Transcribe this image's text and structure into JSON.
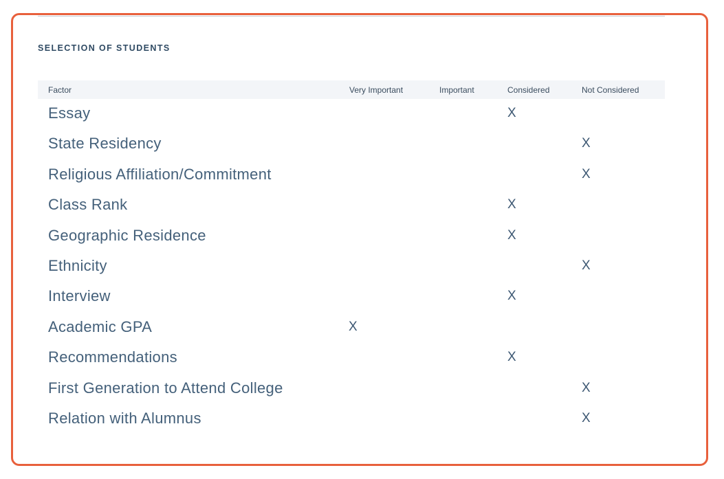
{
  "section": {
    "title": "SELECTION OF STUDENTS"
  },
  "table": {
    "headers": [
      "Factor",
      "Very Important",
      "Important",
      "Considered",
      "Not Considered"
    ],
    "mark_symbol": "X",
    "rows": [
      {
        "factor": "Essay",
        "level": "Considered",
        "vi": "",
        "im": "",
        "co": "X",
        "nc": ""
      },
      {
        "factor": "State Residency",
        "level": "Not Considered",
        "vi": "",
        "im": "",
        "co": "",
        "nc": "X"
      },
      {
        "factor": "Religious Affiliation/Commitment",
        "level": "Not Considered",
        "vi": "",
        "im": "",
        "co": "",
        "nc": "X"
      },
      {
        "factor": "Class Rank",
        "level": "Considered",
        "vi": "",
        "im": "",
        "co": "X",
        "nc": ""
      },
      {
        "factor": "Geographic Residence",
        "level": "Considered",
        "vi": "",
        "im": "",
        "co": "X",
        "nc": ""
      },
      {
        "factor": "Ethnicity",
        "level": "Not Considered",
        "vi": "",
        "im": "",
        "co": "",
        "nc": "X"
      },
      {
        "factor": "Interview",
        "level": "Considered",
        "vi": "",
        "im": "",
        "co": "X",
        "nc": ""
      },
      {
        "factor": "Academic GPA",
        "level": "Very Important",
        "vi": "X",
        "im": "",
        "co": "",
        "nc": ""
      },
      {
        "factor": "Recommendations",
        "level": "Considered",
        "vi": "",
        "im": "",
        "co": "X",
        "nc": ""
      },
      {
        "factor": "First Generation to Attend College",
        "level": "Not Considered",
        "vi": "",
        "im": "",
        "co": "",
        "nc": "X"
      },
      {
        "factor": "Relation with Alumnus",
        "level": "Not Considered",
        "vi": "",
        "im": "",
        "co": "",
        "nc": "X"
      }
    ]
  },
  "colors": {
    "border": "#e8603c",
    "text": "#44607a",
    "header_bg": "#f3f5f8"
  }
}
